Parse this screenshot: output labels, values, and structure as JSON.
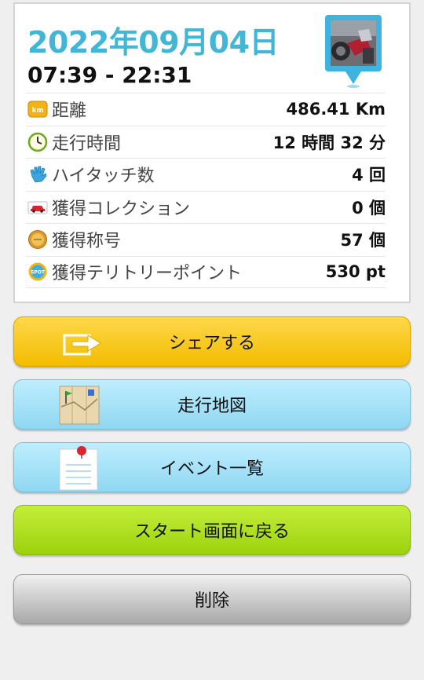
{
  "summary": {
    "date": "2022年09月04日",
    "time_range": "07:39 - 22:31"
  },
  "stats": [
    {
      "icon": "km-badge-icon",
      "label": "距離",
      "value": "486.41 Km"
    },
    {
      "icon": "clock-icon",
      "label": "走行時間",
      "value": "12 時間 32 分"
    },
    {
      "icon": "hand-icon",
      "label": "ハイタッチ数",
      "value": "4 回"
    },
    {
      "icon": "car-icon",
      "label": "獲得コレクション",
      "value": "0 個"
    },
    {
      "icon": "medal-icon",
      "label": "獲得称号",
      "value": "57 個"
    },
    {
      "icon": "spot-icon",
      "label": "獲得テリトリーポイント",
      "value": "530 pt"
    }
  ],
  "buttons": {
    "share": "シェアする",
    "map": "走行地図",
    "events": "イベント一覧",
    "start": "スタート画面に戻る",
    "delete": "削除"
  }
}
